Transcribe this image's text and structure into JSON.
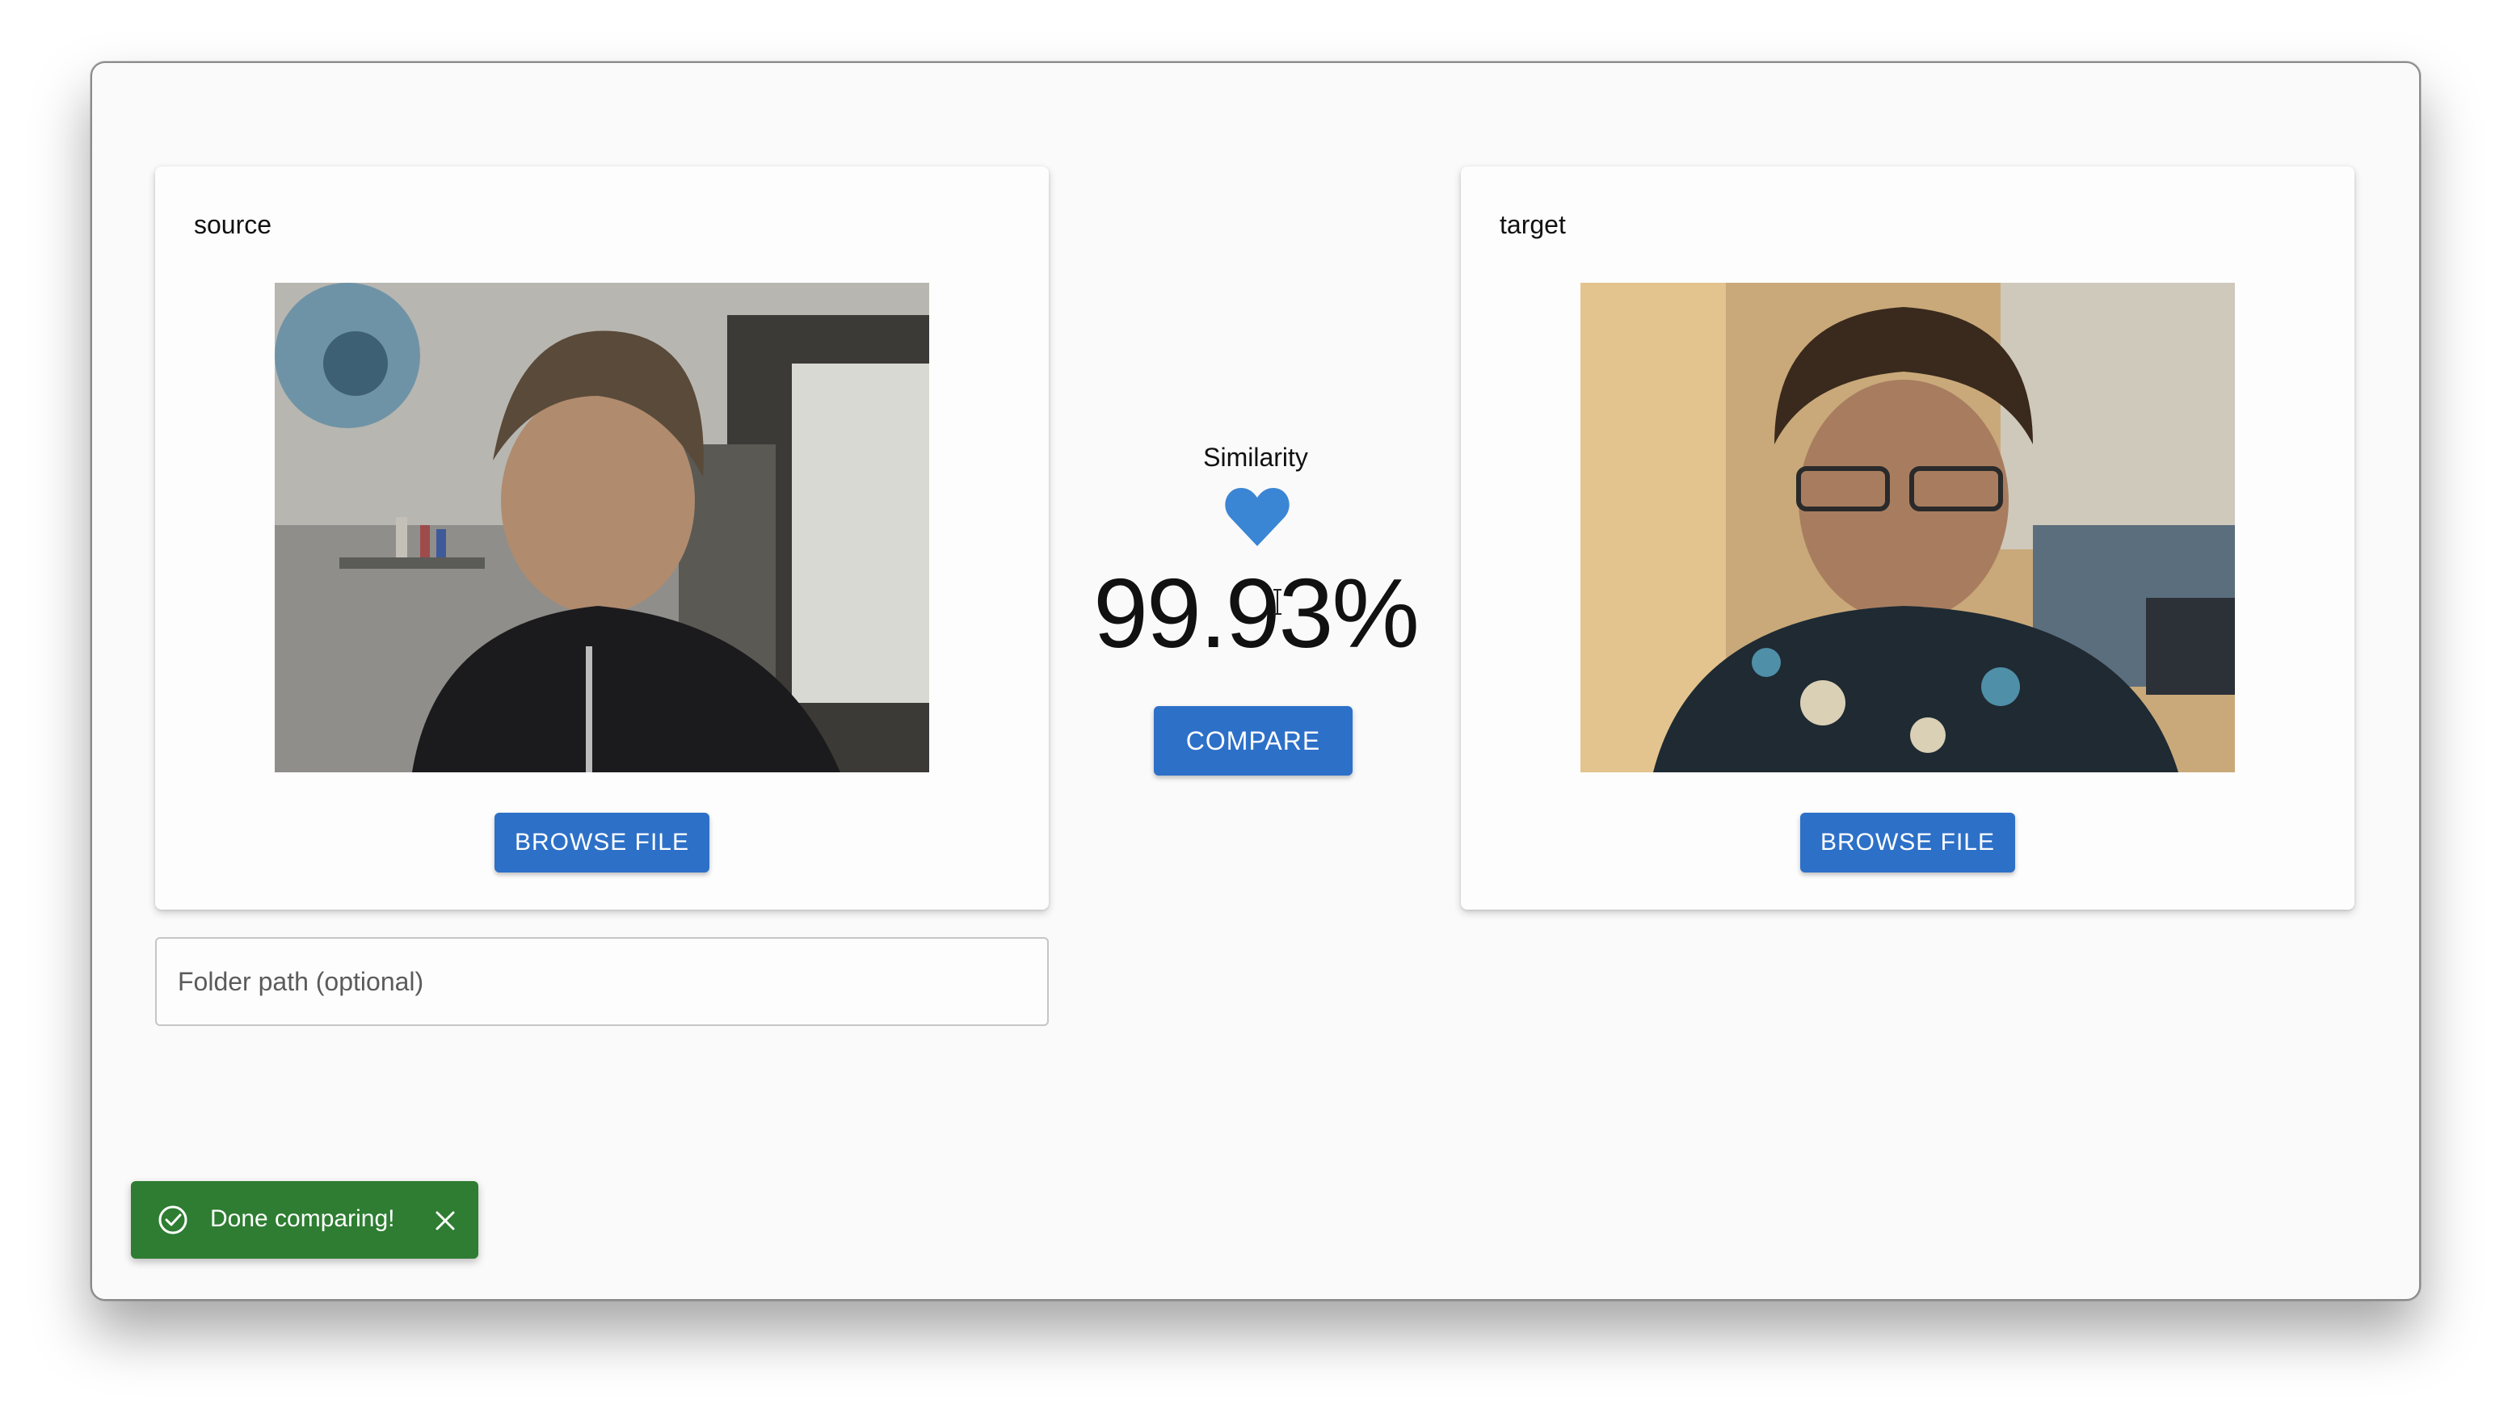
{
  "source_card": {
    "label": "source",
    "browse_label": "BROWSE FILE"
  },
  "target_card": {
    "label": "target",
    "browse_label": "BROWSE FILE"
  },
  "folder_input": {
    "placeholder": "Folder path (optional)",
    "value": ""
  },
  "similarity": {
    "label": "Similarity",
    "value": "99.93%",
    "icon": "heart-icon",
    "compare_label": "COMPARE"
  },
  "toast": {
    "message": "Done comparing!",
    "icon": "check-circle-icon",
    "close_icon": "close-icon"
  },
  "colors": {
    "accent": "#2d70c8",
    "heart": "#3a85d4",
    "toast_success": "#2e7d32",
    "window_bg": "#fafafa"
  }
}
